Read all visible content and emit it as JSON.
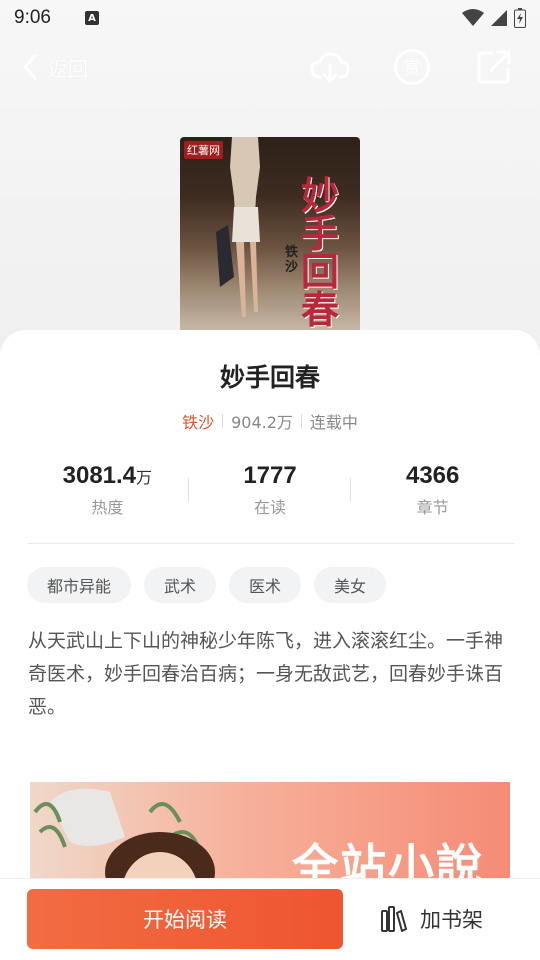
{
  "status_bar": {
    "time": "9:06",
    "keyboard_indicator": "A",
    "icons": [
      "wifi-icon",
      "signal-icon",
      "battery-charging-icon"
    ]
  },
  "nav": {
    "back_label": "返回",
    "icons": [
      "cloud-download-icon",
      "reward-icon",
      "share-icon"
    ]
  },
  "cover": {
    "publisher_logo": "红薯网",
    "title_art": "妙手回春",
    "author_art": "铁沙"
  },
  "book": {
    "title": "妙手回春",
    "author": "铁沙",
    "word_count": "904.2万",
    "status": "连载中"
  },
  "stats": [
    {
      "value": "3081.4",
      "unit": "万",
      "label": "热度"
    },
    {
      "value": "1777",
      "unit": "",
      "label": "在读"
    },
    {
      "value": "4366",
      "unit": "",
      "label": "章节"
    }
  ],
  "tags": [
    "都市异能",
    "武术",
    "医术",
    "美女"
  ],
  "synopsis": "从天武山上下山的神秘少年陈飞，进入滚滚红尘。一手神奇医术，妙手回春治百病；一身无敌武艺，回春妙手诛百恶。",
  "banner": {
    "text": "全站小說"
  },
  "actions": {
    "start_reading": "开始阅读",
    "add_to_shelf": "加书架"
  },
  "colors": {
    "accent": "#EE5530",
    "author": "#E0522B"
  }
}
